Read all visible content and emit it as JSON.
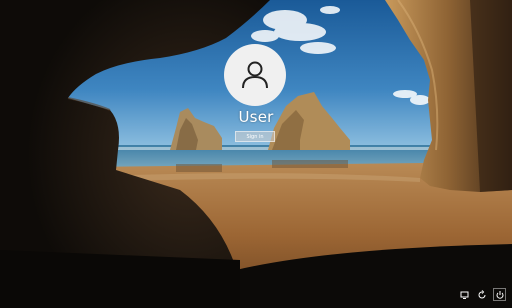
{
  "login": {
    "user_name": "User",
    "sign_in_label": "Sign in"
  },
  "tray": {
    "icons": [
      "network-icon",
      "ease-of-access-icon",
      "power-icon"
    ]
  },
  "colors": {
    "sky_top": "#1d5f9c",
    "sky_bottom": "#7db3d8",
    "sea": "#4f8fb3",
    "sand": "#a9743f",
    "cave": "#15110d"
  }
}
